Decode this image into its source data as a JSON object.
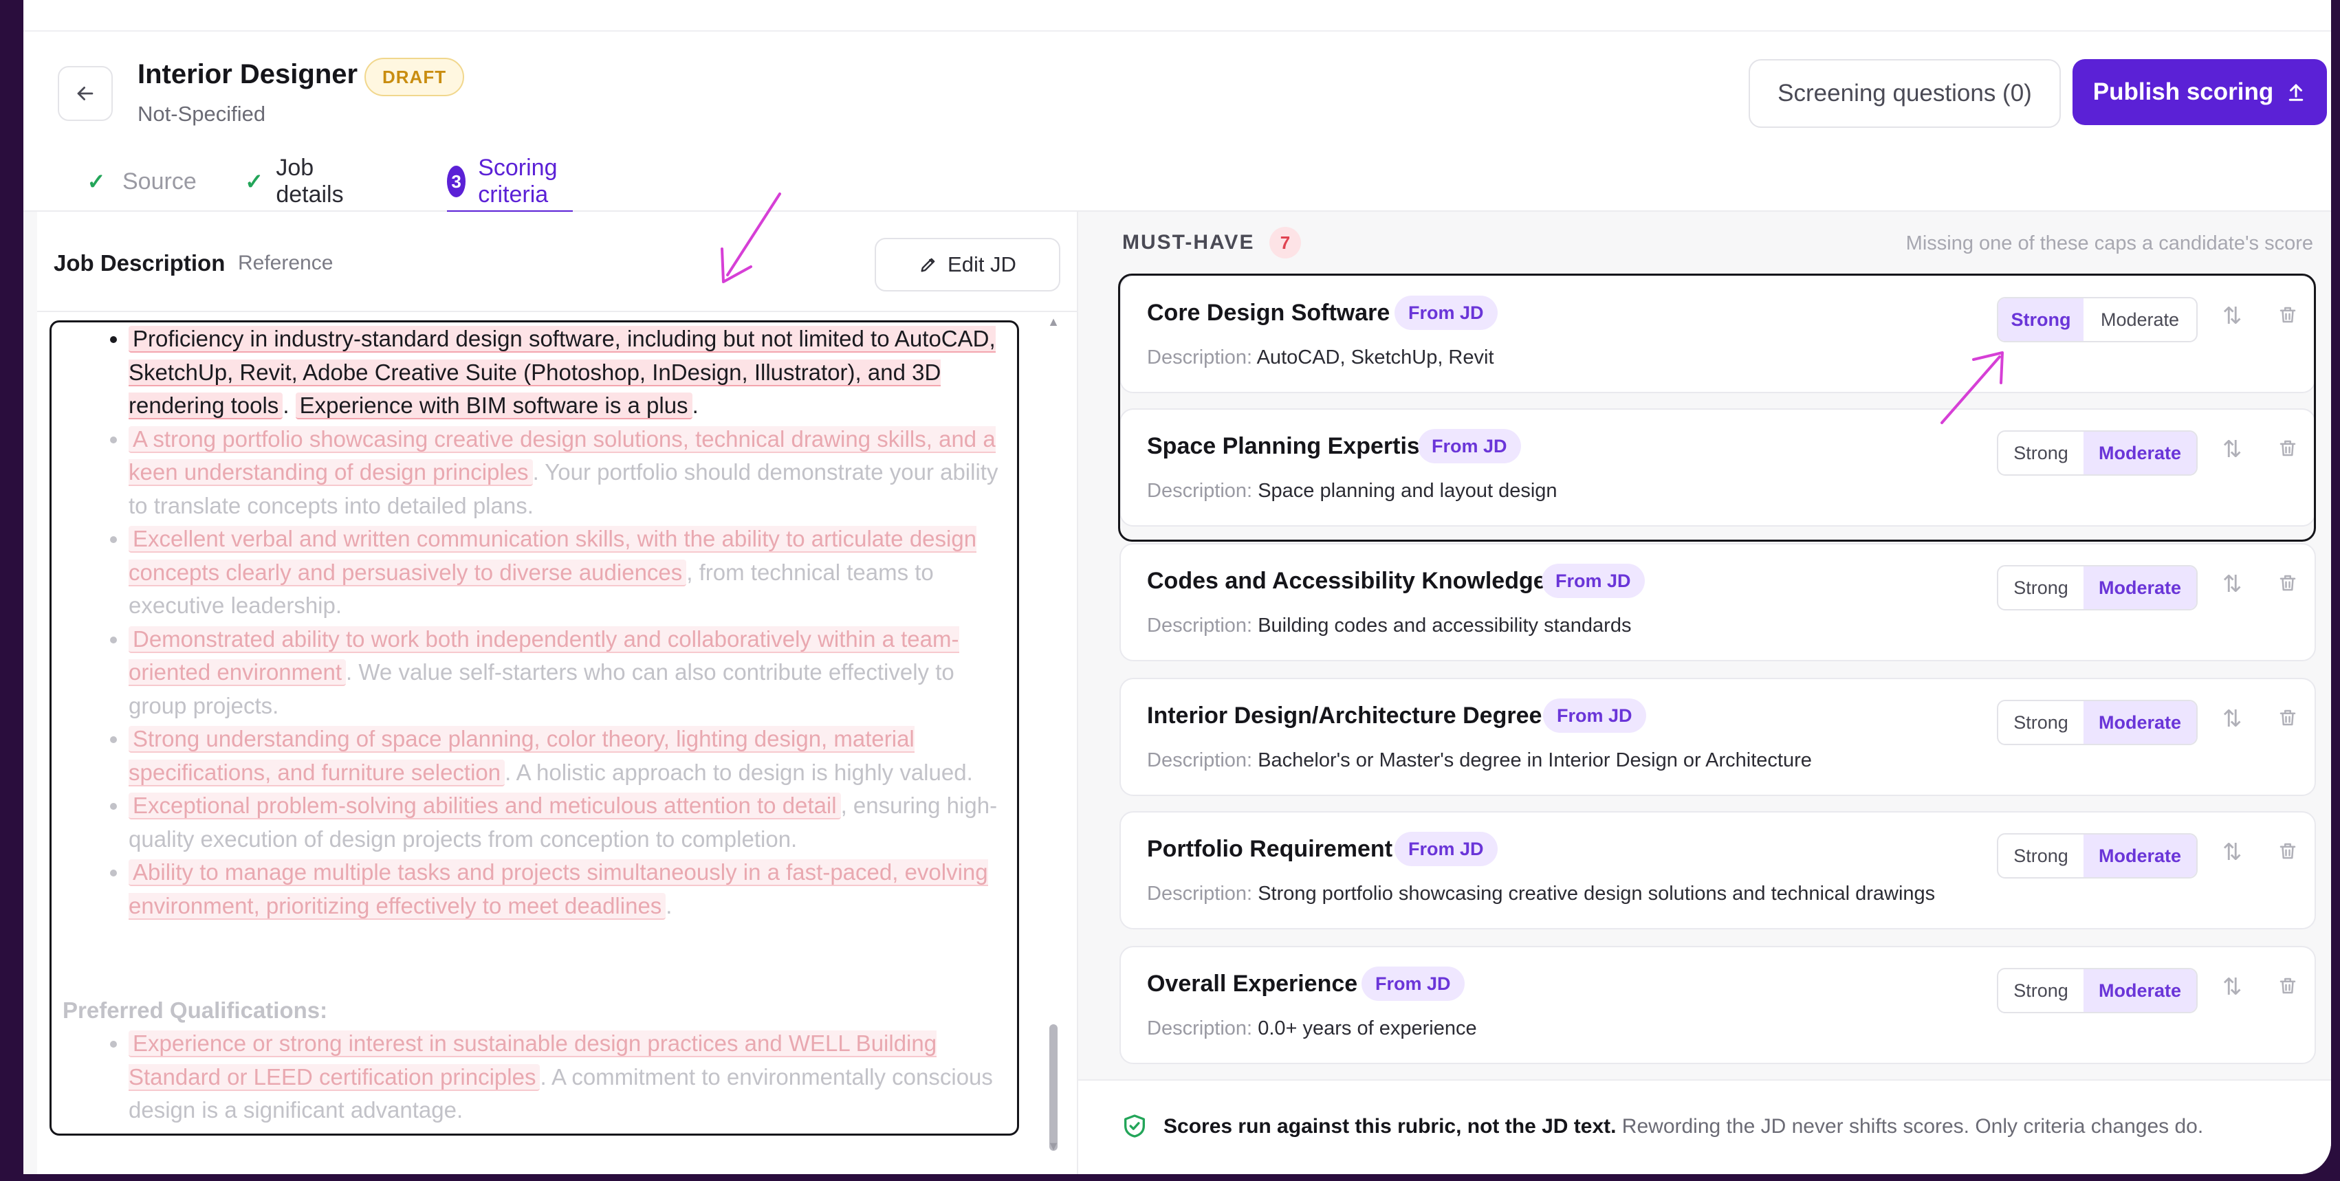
{
  "header": {
    "back_icon": "arrow-left-icon",
    "job_title": "Interior Designer",
    "status_badge": "DRAFT",
    "subtitle": "Not-Specified",
    "screening_button": "Screening questions (0)",
    "publish_button": "Publish scoring",
    "publish_icon": "upload-icon"
  },
  "steps": [
    {
      "label": "Source",
      "state": "done",
      "icon": "check-icon"
    },
    {
      "label": "Job details",
      "state": "done",
      "icon": "check-icon"
    },
    {
      "label": "Scoring criteria",
      "state": "active",
      "number": "3"
    }
  ],
  "left_panel": {
    "title": "Job Description",
    "subtitle": "Reference",
    "edit_button": "Edit JD",
    "edit_icon": "pencil-icon",
    "bullets": [
      {
        "parts": [
          {
            "hl": "Proficiency in industry-standard design software, including but not limited to AutoCAD, SketchUp, Revit, Adobe Creative Suite (Photoshop, InDesign, Illustrator), and 3D rendering tools"
          },
          {
            "t": ". "
          },
          {
            "hl": "Experience with BIM software is a plus"
          },
          {
            "t": "."
          }
        ],
        "active": true
      },
      {
        "parts": [
          {
            "hl": "A strong portfolio showcasing creative design solutions, technical drawing skills, and a keen understanding of design principles"
          },
          {
            "t": ". Your portfolio should demonstrate your ability to translate concepts into detailed plans."
          }
        ]
      },
      {
        "parts": [
          {
            "hl": "Excellent verbal and written communication skills, with the ability to articulate design concepts clearly and persuasively to diverse audiences"
          },
          {
            "t": ", from technical teams to executive leadership."
          }
        ]
      },
      {
        "parts": [
          {
            "hl": "Demonstrated ability to work both independently and collaboratively within a team-oriented environment"
          },
          {
            "t": ". We value self-starters who can also contribute effectively to group projects."
          }
        ]
      },
      {
        "parts": [
          {
            "hl": "Strong understanding of space planning, color theory, lighting design, material specifications, and furniture selection"
          },
          {
            "t": ". A holistic approach to design is highly valued."
          }
        ]
      },
      {
        "parts": [
          {
            "hl": "Exceptional problem-solving abilities and meticulous attention to detail"
          },
          {
            "t": ", ensuring high-quality execution of design projects from conception to completion."
          }
        ]
      },
      {
        "parts": [
          {
            "hl": "Ability to manage multiple tasks and projects simultaneously in a fast-paced, evolving environment, prioritizing effectively to meet deadlines"
          },
          {
            "t": "."
          }
        ]
      }
    ],
    "preferred_heading": "Preferred Qualifications:",
    "preferred_bullets": [
      {
        "parts": [
          {
            "hl": "Experience or strong interest in sustainable design practices and WELL Building Standard or LEED certification principles"
          },
          {
            "t": ". A commitment to environmentally conscious design is a significant advantage."
          }
        ]
      }
    ]
  },
  "right_panel": {
    "section_label": "MUST-HAVE",
    "count": "7",
    "note": "Missing one of these caps a candidate's score",
    "criteria": [
      {
        "title": "Core Design Software",
        "tag": "From JD",
        "desc_label": "Description:",
        "desc": "AutoCAD, SketchUp, Revit",
        "selected": "Strong"
      },
      {
        "title": "Space Planning Expertise",
        "tag": "From JD",
        "desc_label": "Description:",
        "desc": "Space planning and layout design",
        "selected": "Moderate"
      },
      {
        "title": "Codes and Accessibility Knowledge",
        "tag": "From JD",
        "desc_label": "Description:",
        "desc": "Building codes and accessibility standards",
        "selected": "Moderate"
      },
      {
        "title": "Interior Design/Architecture Degree",
        "tag": "From JD",
        "desc_label": "Description:",
        "desc": "Bachelor's or Master's degree in Interior Design or Architecture",
        "selected": "Moderate"
      },
      {
        "title": "Portfolio Requirement",
        "tag": "From JD",
        "desc_label": "Description:",
        "desc": "Strong portfolio showcasing creative design solutions and technical drawings",
        "selected": "Moderate"
      },
      {
        "title": "Overall Experience",
        "tag": "From JD",
        "desc_label": "Description:",
        "desc": "0.0+ years of experience",
        "selected": "Moderate"
      }
    ],
    "strong_label": "Strong",
    "moderate_label": "Moderate",
    "footer_strong": "Scores run against this rubric, not the JD text.",
    "footer_rest": " Rewording the JD never shifts scores. Only criteria changes do.",
    "footer_icon": "shield-check-icon"
  },
  "colors": {
    "accent": "#5b21d6",
    "tag_bg": "#efe7ff",
    "draft": "#c98d10",
    "highlight": "#fde3e6",
    "annotation_arrow": "#d63fd6"
  }
}
